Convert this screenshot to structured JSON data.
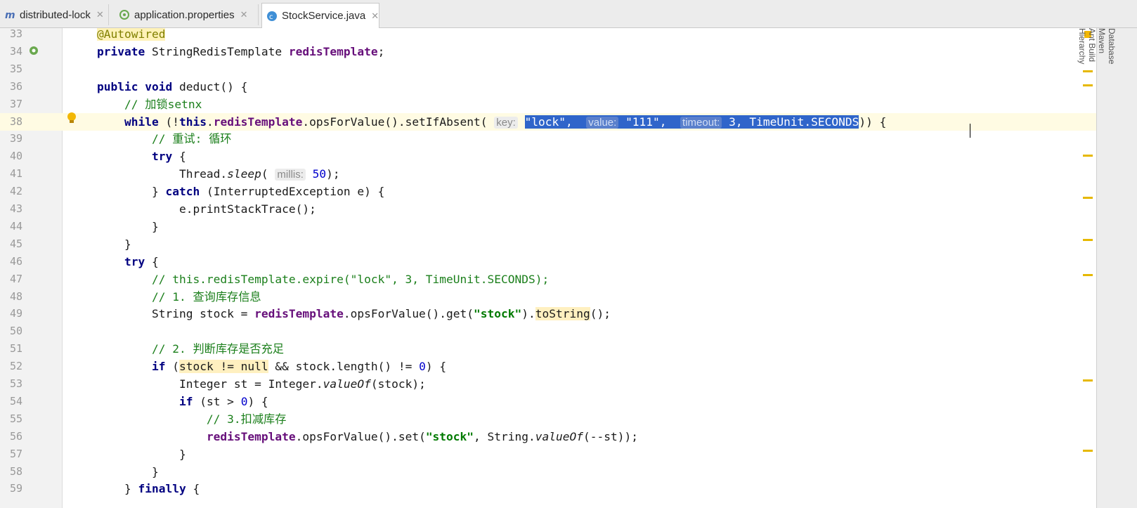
{
  "tabs": [
    {
      "label": "distributed-lock",
      "icon": "module-icon",
      "active": false
    },
    {
      "label": "application.properties",
      "icon": "properties-file-icon",
      "active": false
    },
    {
      "label": "StockService.java",
      "icon": "java-class-icon",
      "active": true
    }
  ],
  "right_tools": [
    "Database",
    "Maven",
    "Ant Build",
    "Hierarchy"
  ],
  "colors": {
    "selection": "#2f65ca",
    "keyword": "#000080",
    "field": "#660e7a",
    "string": "#007a00",
    "comment": "#1b7f1b"
  },
  "lines": [
    {
      "n": "33",
      "segs": [
        [
          "@Autowired",
          "ann"
        ]
      ]
    },
    {
      "n": "34",
      "segs": [
        [
          "private ",
          "kw"
        ],
        [
          "StringRedisTemplate ",
          ""
        ],
        [
          "redisTemplate",
          "field"
        ],
        [
          ";",
          ""
        ]
      ]
    },
    {
      "n": "35",
      "segs": []
    },
    {
      "n": "36",
      "segs": [
        [
          "public void ",
          "kw"
        ],
        [
          "deduct() {",
          ""
        ]
      ]
    },
    {
      "n": "37",
      "segs": [
        [
          "    // 加锁setnx",
          "cmt"
        ]
      ]
    },
    {
      "n": "38",
      "segs": [
        [
          "    ",
          ""
        ],
        [
          "while ",
          "kw"
        ],
        [
          "(!",
          ""
        ],
        [
          "this",
          "kw"
        ],
        [
          ".",
          ""
        ],
        [
          "redisTemplate",
          "field"
        ],
        [
          ".opsForValue().setIfAbsent( ",
          ""
        ],
        [
          "key:",
          "hint"
        ],
        [
          " ",
          ""
        ],
        [
          "\"lock\", ",
          "sel"
        ],
        [
          " value: ",
          "selhint"
        ],
        [
          "\"111\", ",
          "sel"
        ],
        [
          " timeout: ",
          "selhint"
        ],
        [
          "3, TimeUnit.SECONDS",
          "sel"
        ],
        [
          ")) {",
          ""
        ]
      ]
    },
    {
      "n": "39",
      "segs": [
        [
          "        // 重试: 循环",
          "cmt"
        ]
      ]
    },
    {
      "n": "40",
      "segs": [
        [
          "        ",
          ""
        ],
        [
          "try ",
          "kw"
        ],
        [
          "{",
          ""
        ]
      ]
    },
    {
      "n": "41",
      "segs": [
        [
          "            Thread.",
          ""
        ],
        [
          "sleep",
          "ital"
        ],
        [
          "( ",
          ""
        ],
        [
          "millis:",
          "hint"
        ],
        [
          " ",
          ""
        ],
        [
          "50",
          "num"
        ],
        [
          ");",
          ""
        ]
      ]
    },
    {
      "n": "42",
      "segs": [
        [
          "        } ",
          ""
        ],
        [
          "catch ",
          "kw"
        ],
        [
          "(InterruptedException e) {",
          ""
        ]
      ]
    },
    {
      "n": "43",
      "segs": [
        [
          "            e.printStackTrace();",
          ""
        ]
      ]
    },
    {
      "n": "44",
      "segs": [
        [
          "        }",
          ""
        ]
      ]
    },
    {
      "n": "45",
      "segs": [
        [
          "    }",
          ""
        ]
      ]
    },
    {
      "n": "46",
      "segs": [
        [
          "    ",
          ""
        ],
        [
          "try ",
          "kw"
        ],
        [
          "{",
          ""
        ]
      ]
    },
    {
      "n": "47",
      "segs": [
        [
          "        // this.redisTemplate.expire(\"lock\", 3, TimeUnit.SECONDS);",
          "cmt"
        ]
      ]
    },
    {
      "n": "48",
      "segs": [
        [
          "        // 1. 查询库存信息",
          "cmt"
        ]
      ]
    },
    {
      "n": "49",
      "segs": [
        [
          "        String stock = ",
          ""
        ],
        [
          "redisTemplate",
          "field"
        ],
        [
          ".opsForValue().get(",
          ""
        ],
        [
          "\"stock\"",
          "str"
        ],
        [
          ").",
          ""
        ],
        [
          "toString",
          "warnhl"
        ],
        [
          "();",
          ""
        ]
      ]
    },
    {
      "n": "50",
      "segs": []
    },
    {
      "n": "51",
      "segs": [
        [
          "        // 2. 判断库存是否充足",
          "cmt"
        ]
      ]
    },
    {
      "n": "52",
      "segs": [
        [
          "        ",
          ""
        ],
        [
          "if ",
          "kw"
        ],
        [
          "(",
          ""
        ],
        [
          "stock != null",
          "warnhl"
        ],
        [
          " && stock.length() != ",
          ""
        ],
        [
          "0",
          "num"
        ],
        [
          ") {",
          ""
        ]
      ]
    },
    {
      "n": "53",
      "segs": [
        [
          "            Integer st = Integer.",
          ""
        ],
        [
          "valueOf",
          "ital"
        ],
        [
          "(stock);",
          ""
        ]
      ]
    },
    {
      "n": "54",
      "segs": [
        [
          "            ",
          ""
        ],
        [
          "if ",
          "kw"
        ],
        [
          "(st > ",
          ""
        ],
        [
          "0",
          "num"
        ],
        [
          ") {",
          ""
        ]
      ]
    },
    {
      "n": "55",
      "segs": [
        [
          "                // 3.扣减库存",
          "cmt"
        ]
      ]
    },
    {
      "n": "56",
      "segs": [
        [
          "                ",
          ""
        ],
        [
          "redisTemplate",
          "field"
        ],
        [
          ".opsForValue().set(",
          ""
        ],
        [
          "\"stock\"",
          "str"
        ],
        [
          ", String.",
          ""
        ],
        [
          "valueOf",
          "ital"
        ],
        [
          "(--st));",
          ""
        ]
      ]
    },
    {
      "n": "57",
      "segs": [
        [
          "            }",
          ""
        ]
      ]
    },
    {
      "n": "58",
      "segs": [
        [
          "        }",
          ""
        ]
      ]
    },
    {
      "n": "59",
      "segs": [
        [
          "    } ",
          ""
        ],
        [
          "finally ",
          "kw"
        ],
        [
          "{",
          ""
        ]
      ]
    }
  ]
}
